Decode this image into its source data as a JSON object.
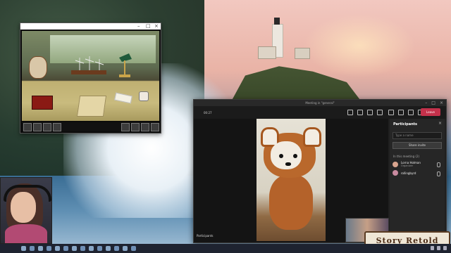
{
  "game_window": {
    "status_text": "",
    "inventory_left": [
      "slot-1",
      "slot-2",
      "slot-3",
      "slot-4",
      "slot-5"
    ],
    "inventory_right": [
      "slot-6",
      "slot-7",
      "slot-8",
      "slot-9"
    ]
  },
  "call_window": {
    "title": "Meeting in \"general\"",
    "timer": "00:27",
    "leave_label": "Leave",
    "self_view_label": "Participants",
    "main_video_label": "",
    "participants_panel": {
      "title": "Participants",
      "invite_placeholder": "Type a name",
      "share_invite_label": "Share invite",
      "section_label": "In this meeting (2)",
      "people": [
        {
          "name": "Lorna Holman",
          "role": "Organizer"
        },
        {
          "name": "rollingbyrd",
          "role": ""
        }
      ]
    },
    "self_label": "Participants"
  },
  "logo": {
    "text": "Story Retold"
  },
  "taskbar": {
    "icons": [
      "start-icon",
      "search-icon",
      "taskview-icon",
      "explorer-icon",
      "edge-icon",
      "store-icon",
      "mail-icon",
      "teams-icon",
      "discord-icon",
      "steam-icon",
      "obs-icon",
      "photos-icon",
      "spotify-icon",
      "chrome-icon"
    ]
  }
}
